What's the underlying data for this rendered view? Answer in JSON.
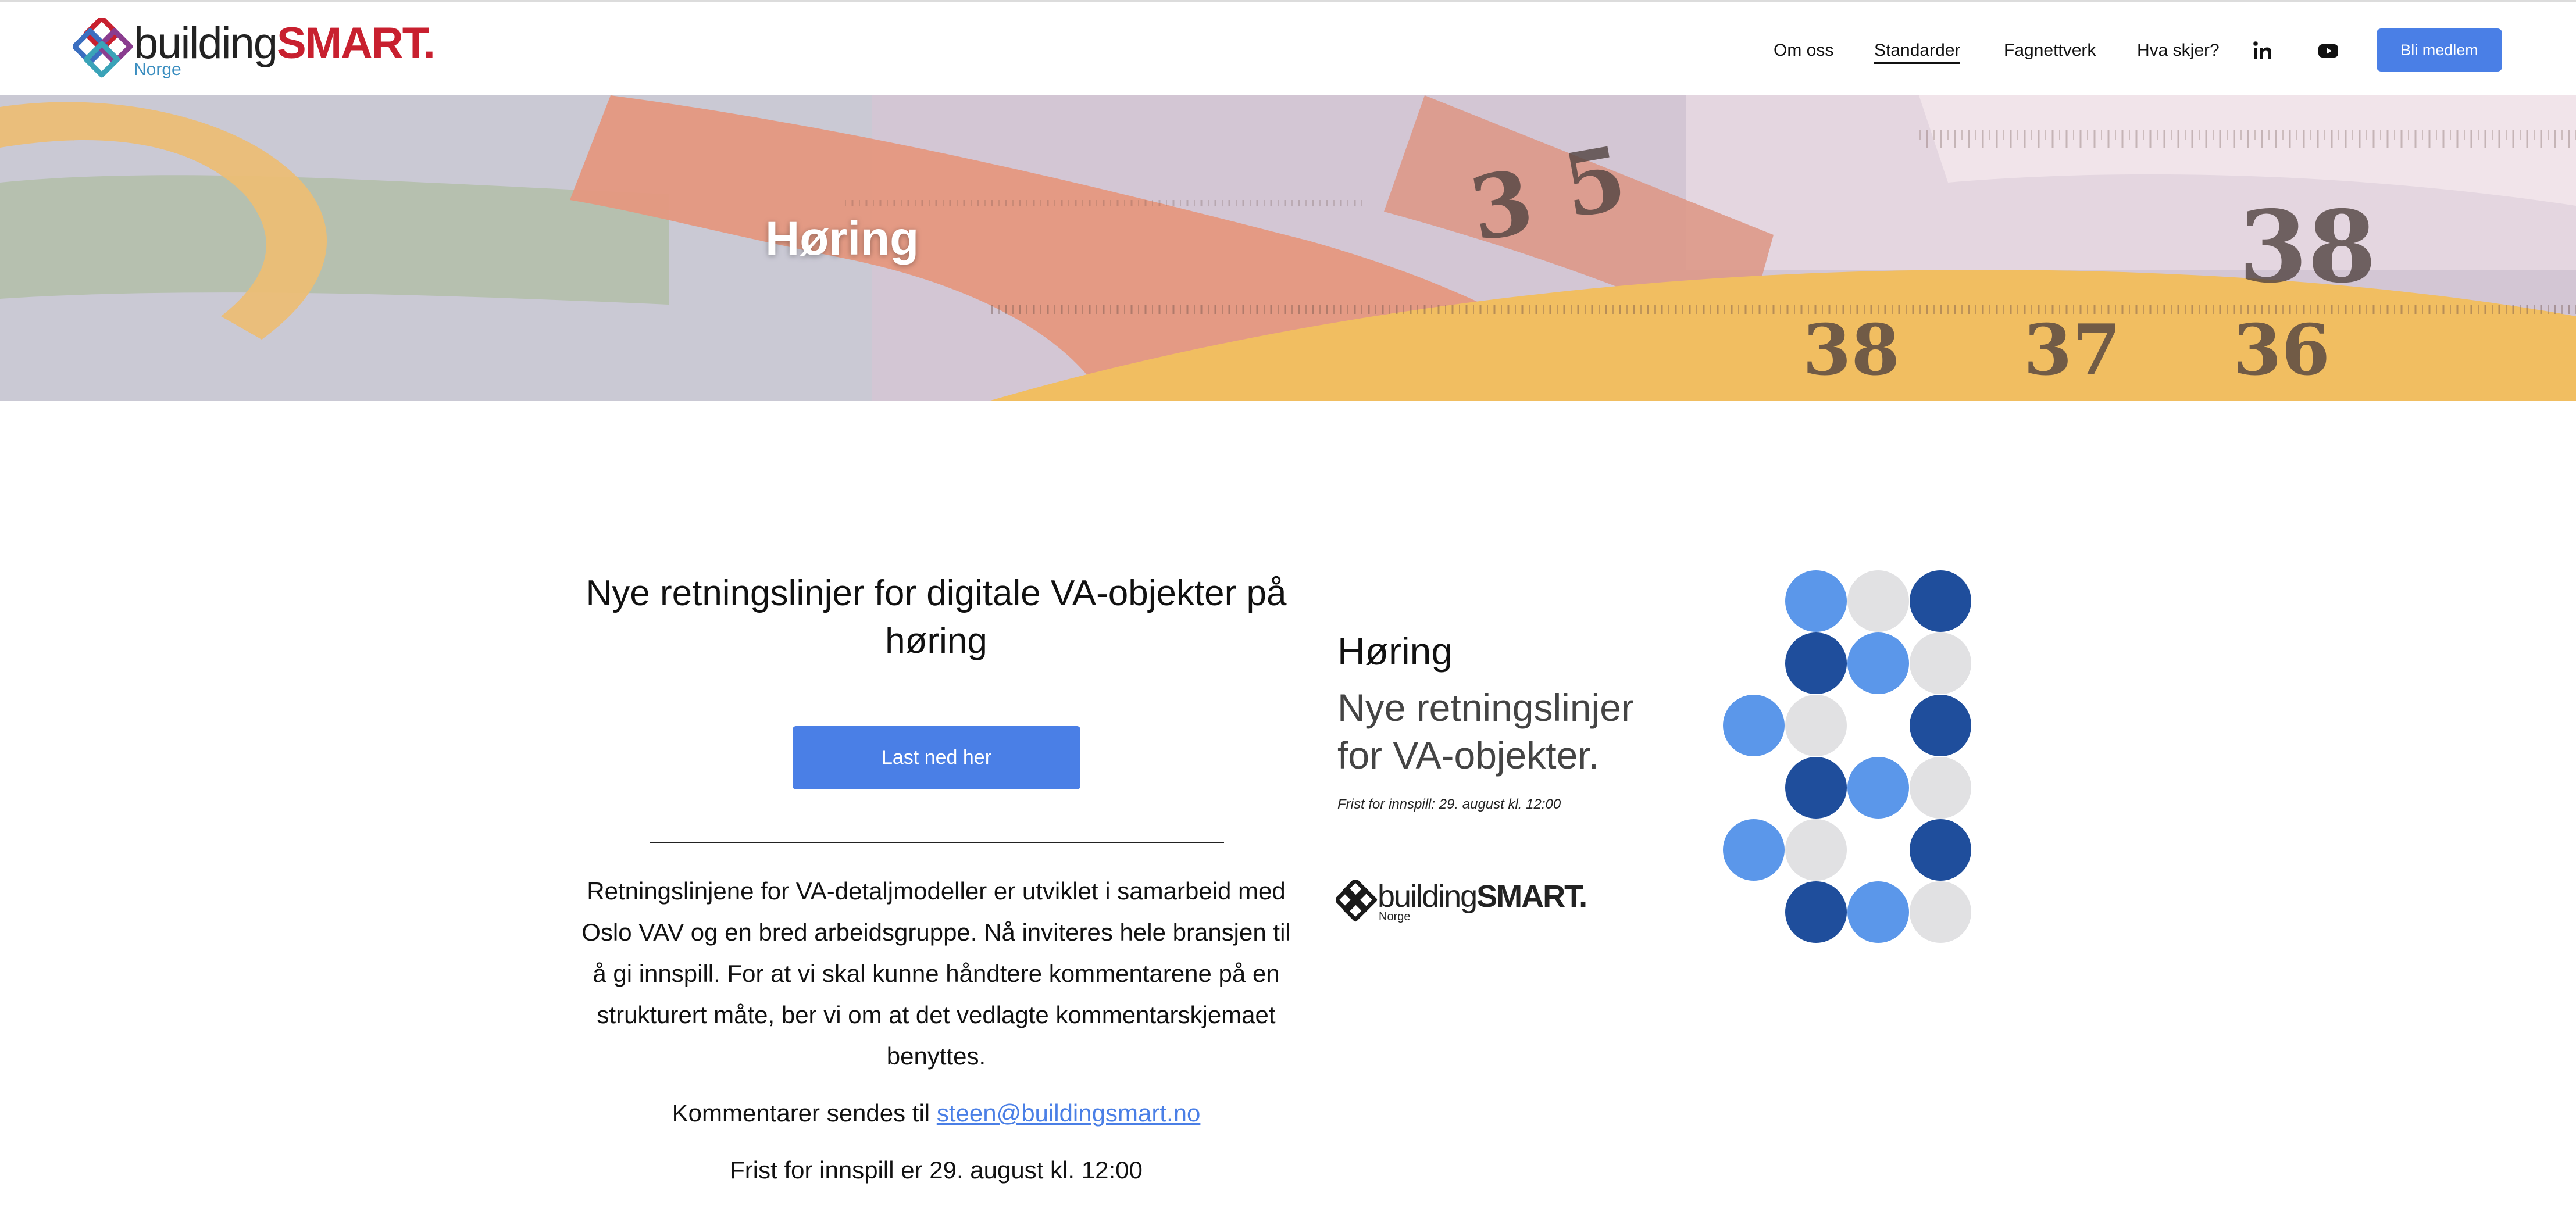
{
  "header": {
    "logo": {
      "word_a": "building",
      "word_b": "SMART.",
      "sub": "Norge"
    },
    "nav": [
      {
        "label": "Om oss",
        "active": false
      },
      {
        "label": "Standarder",
        "active": true
      },
      {
        "label": "Fagnettverk",
        "active": false
      },
      {
        "label": "Hva skjer?",
        "active": false
      }
    ],
    "social": [
      "linkedin-icon",
      "youtube-icon"
    ],
    "cta_label": "Bli medlem"
  },
  "hero": {
    "title": "Høring"
  },
  "main": {
    "title": "Nye retningslinjer for digitale VA-objekter på høring",
    "download_label": "Last ned her",
    "paragraph": "Retningslinjene for VA-detaljmodeller er utviklet i samarbeid med Oslo VAV og en bred arbeidsgruppe. Nå inviteres hele bransjen til å gi innspill. For at vi skal kunne håndtere kommentarene på en strukturert måte, ber vi om at det vedlagte kommentarskjemaet benyttes.",
    "contact_prefix": "Kommentarer sendes til",
    "contact_email": "steen@buildingsmart.no",
    "deadline": "Frist for innspill er 29. august kl. 12:00"
  },
  "promo": {
    "heading": "Høring",
    "subtitle": "Nye retningslinjer for VA-objekter.",
    "deadline": "Frist for innspill: 29. august kl. 12:00",
    "logo_word_a": "building",
    "logo_word_b": "SMART.",
    "logo_sub": "Norge"
  },
  "colors": {
    "accent": "#4a7fe6",
    "brand_red": "#c8202f",
    "dot_dark": "#1f4e9c",
    "dot_light": "#5b97ea",
    "dot_grey": "#e1e1e3"
  }
}
